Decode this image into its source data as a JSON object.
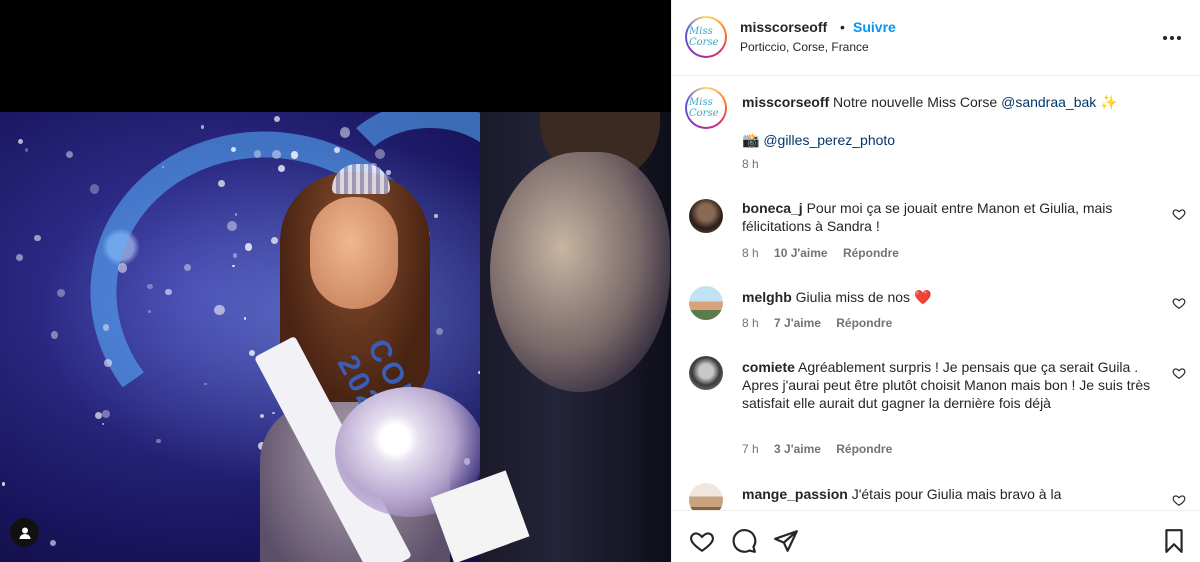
{
  "post": {
    "username": "misscorseoff",
    "separator": "•",
    "follow_label": "Suivre",
    "location": "Porticcio, Corse, France",
    "avatar_text": "Miss Corse",
    "photo_sash_text": "CORSE 2023"
  },
  "caption": {
    "username": "misscorseoff",
    "text_before": "Notre nouvelle Miss Corse ",
    "mention": "@sandraa_bak",
    "emoji": "✨",
    "credit_emoji": "📸",
    "credit_mention": "@gilles_perez_photo",
    "time": "8 h"
  },
  "comments": [
    {
      "username": "boneca_j",
      "text": "Pour moi ça se jouait entre Manon et Giulia, mais félicitations à Sandra !",
      "time": "8 h",
      "likes": "10 J'aime",
      "reply": "Répondre"
    },
    {
      "username": "melghb",
      "text": "Giulia miss de nos",
      "emoji": "❤️",
      "time": "8 h",
      "likes": "7 J'aime",
      "reply": "Répondre"
    },
    {
      "username": "comiete",
      "text": "Agréablement surpris ! Je pensais que ça serait Guila . Apres j'aurai peut être plutôt choisit Manon mais bon ! Je suis très satisfait elle aurait dut gagner la dernière fois déjà",
      "time": "7 h",
      "likes": "3 J'aime",
      "reply": "Répondre"
    },
    {
      "username": "mange_passion",
      "text": "J'étais pour Giulia mais bravo à la",
      "time": "",
      "likes": "",
      "reply": ""
    }
  ],
  "icons": {
    "more": "more-horizontal-icon",
    "like": "heart-outline-icon",
    "comment": "comment-bubble-icon",
    "share": "paper-plane-icon",
    "save": "bookmark-icon",
    "tagged_user": "user-tag-icon"
  },
  "colors": {
    "link": "#0095f6",
    "mention": "#00376b",
    "meta": "#737373",
    "text": "#262626",
    "heart": "#ed1c24"
  }
}
